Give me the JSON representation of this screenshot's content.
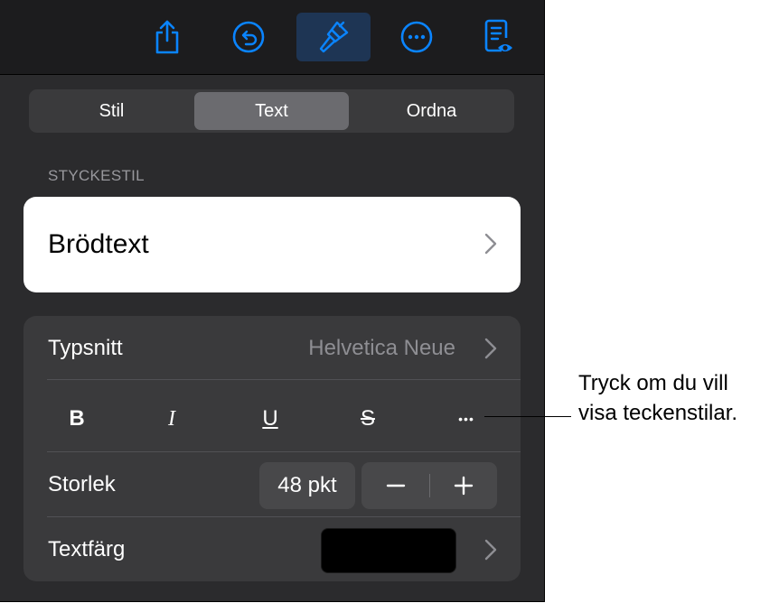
{
  "tabs": [
    {
      "label": "Stil",
      "selected": false
    },
    {
      "label": "Text",
      "selected": true
    },
    {
      "label": "Ordna",
      "selected": false
    }
  ],
  "toolbar": {
    "icons": [
      "share-icon",
      "undo-icon",
      "format-paintbrush-icon",
      "more-icon",
      "reading-view-icon"
    ],
    "accent": "#0a84ff"
  },
  "paragraph_style": {
    "section_label": "STYCKESTIL",
    "value": "Brödtext"
  },
  "font": {
    "label": "Typsnitt",
    "value": "Helvetica Neue"
  },
  "text_styles": {
    "bold": "B",
    "italic": "I",
    "underline": "U",
    "strikethrough": "S",
    "more": "•••"
  },
  "size": {
    "label": "Storlek",
    "value": "48 pkt"
  },
  "text_color": {
    "label": "Textfärg",
    "value": "#000000"
  },
  "callout": {
    "line1": "Tryck om du vill",
    "line2": "visa teckenstilar."
  }
}
